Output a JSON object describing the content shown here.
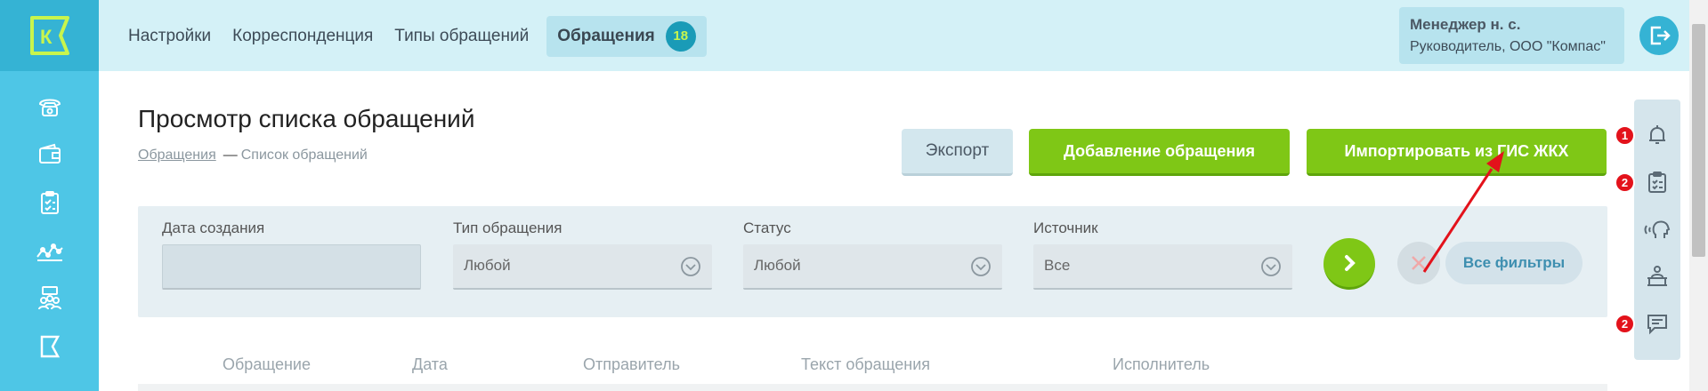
{
  "nav": {
    "items": [
      {
        "label": "Настройки"
      },
      {
        "label": "Корреспонденция"
      },
      {
        "label": "Типы обращений"
      }
    ],
    "active": {
      "label": "Обращения",
      "badge": "18"
    }
  },
  "logo": {
    "letter": "К"
  },
  "user": {
    "name": "Менеджер н. с.",
    "role": "Руководитель, ООО \"Компас\""
  },
  "page": {
    "title": "Просмотр списка обращений",
    "breadcrumb": {
      "link": "Обращения",
      "separator": "—",
      "current": "Список обращений"
    }
  },
  "actions": {
    "export": "Экспорт",
    "add": "Добавление обращения",
    "import": "Импортировать из ГИС ЖКХ"
  },
  "filters": {
    "date": {
      "label": "Дата создания",
      "value": ""
    },
    "type": {
      "label": "Тип обращения",
      "value": "Любой"
    },
    "status": {
      "label": "Статус",
      "value": "Любой"
    },
    "source": {
      "label": "Источник",
      "value": "Все"
    },
    "all_filters": "Все фильтры"
  },
  "table": {
    "columns": [
      "Обращение",
      "Дата",
      "Отправитель",
      "Текст обращения",
      "Исполнитель"
    ]
  },
  "right_panel": {
    "notifications_badge": "1",
    "tasks_badge": "2",
    "messages_badge": "2"
  },
  "colors": {
    "sidebar": "#4ec6e6",
    "topbar": "#d4f1f7",
    "accent_green": "#7fc716",
    "badge_teal": "#1a9bb7",
    "badge_red": "#e3121b"
  }
}
